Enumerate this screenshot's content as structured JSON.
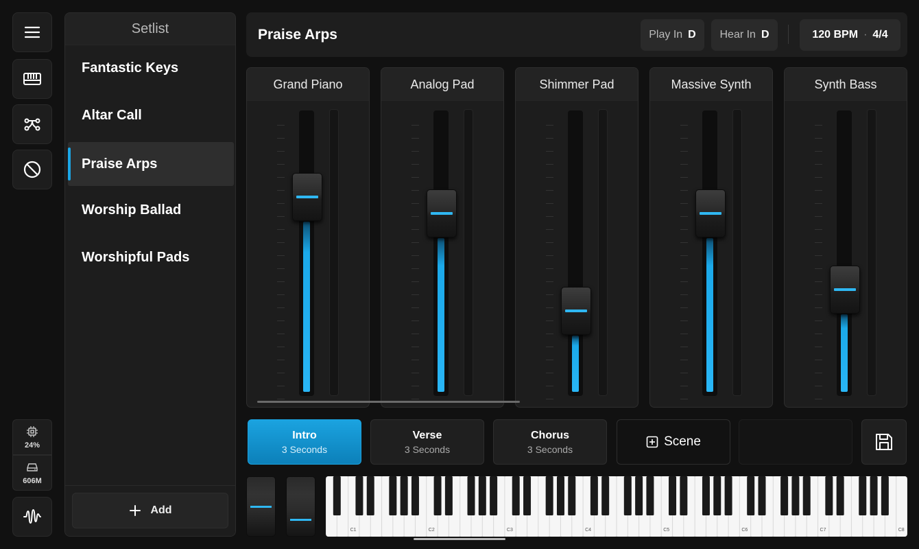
{
  "rail": {
    "menu_icon": "hamburger-menu-icon",
    "keyboard_icon": "keyboard-icon",
    "routing_icon": "routing-icon",
    "panic_icon": "stop-icon",
    "cpu": {
      "icon": "cpu-icon",
      "value": "24%"
    },
    "memory": {
      "icon": "drive-icon",
      "value": "606M"
    },
    "audio_icon": "waveform-icon"
  },
  "setlist": {
    "title": "Setlist",
    "songs": [
      {
        "name": "Fantastic Keys",
        "active": false
      },
      {
        "name": "Altar Call",
        "active": false
      },
      {
        "name": "Praise Arps",
        "active": true
      },
      {
        "name": "Worship Ballad",
        "active": false
      },
      {
        "name": "Worshipful Pads",
        "active": false
      }
    ],
    "add_label": "Add"
  },
  "header": {
    "song_title": "Praise Arps",
    "play_in_label": "Play In",
    "play_in_key": "D",
    "hear_in_label": "Hear In",
    "hear_in_key": "D",
    "tempo": "120 BPM",
    "separator": "·",
    "time_signature": "4/4"
  },
  "mixer": {
    "channels": [
      {
        "name": "Grand Piano",
        "level": 0.74
      },
      {
        "name": "Analog Pad",
        "level": 0.68
      },
      {
        "name": "Shimmer Pad",
        "level": 0.31
      },
      {
        "name": "Massive Synth",
        "level": 0.68
      },
      {
        "name": "Synth Bass",
        "level": 0.39
      }
    ]
  },
  "scenes": [
    {
      "name": "Intro",
      "duration": "3 Seconds",
      "active": true
    },
    {
      "name": "Verse",
      "duration": "3 Seconds",
      "active": false
    },
    {
      "name": "Chorus",
      "duration": "3 Seconds",
      "active": false
    }
  ],
  "add_scene_label": "Scene",
  "save_icon": "save-icon",
  "keyboard": {
    "octave_labels": [
      "C1",
      "C2",
      "C3",
      "C4",
      "C5",
      "C6",
      "C7",
      "C8"
    ]
  },
  "colors": {
    "accent": "#1ba6e6",
    "background": "#111111",
    "panel": "#1d1d1d"
  }
}
